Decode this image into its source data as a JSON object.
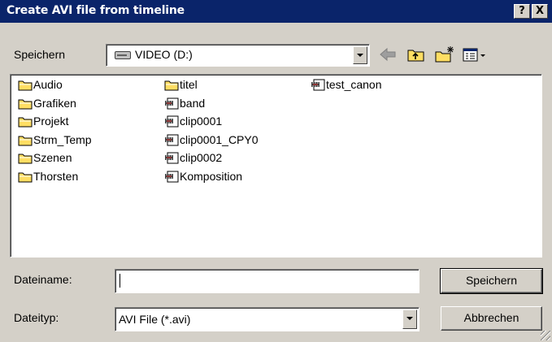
{
  "window": {
    "title": "Create AVI file from timeline"
  },
  "titlebar": {
    "help_label": "?",
    "close_label": "X"
  },
  "save_in": {
    "label": "Speichern",
    "drive_value": "VIDEO (D:)",
    "icon": "drive-icon"
  },
  "toolbar": [
    {
      "name": "back-button",
      "icon": "back-arrow-icon"
    },
    {
      "name": "up-folder-button",
      "icon": "folder-up-icon"
    },
    {
      "name": "new-folder-button",
      "icon": "new-folder-icon"
    },
    {
      "name": "view-menu-button",
      "icon": "view-menu-icon"
    }
  ],
  "files": [
    {
      "name": "Audio",
      "type": "folder"
    },
    {
      "name": "Grafiken",
      "type": "folder"
    },
    {
      "name": "Projekt",
      "type": "folder"
    },
    {
      "name": "Strm_Temp",
      "type": "folder"
    },
    {
      "name": "Szenen",
      "type": "folder"
    },
    {
      "name": "Thorsten",
      "type": "folder"
    },
    {
      "name": "titel",
      "type": "folder"
    },
    {
      "name": "band",
      "type": "avi"
    },
    {
      "name": "clip0001",
      "type": "avi"
    },
    {
      "name": "clip0001_CPY0",
      "type": "avi"
    },
    {
      "name": "clip0002",
      "type": "avi"
    },
    {
      "name": "Komposition",
      "type": "avi"
    },
    {
      "name": "test_canon",
      "type": "avi"
    }
  ],
  "filename": {
    "label": "Dateiname:",
    "value": ""
  },
  "filetype": {
    "label": "Dateityp:",
    "value": "AVI File (*.avi)"
  },
  "buttons": {
    "save_label": "Speichern",
    "cancel_label": "Abbrechen"
  },
  "colors": {
    "titlebar": "#0a246a",
    "face": "#d4d0c8",
    "folder": "#ffde63"
  }
}
